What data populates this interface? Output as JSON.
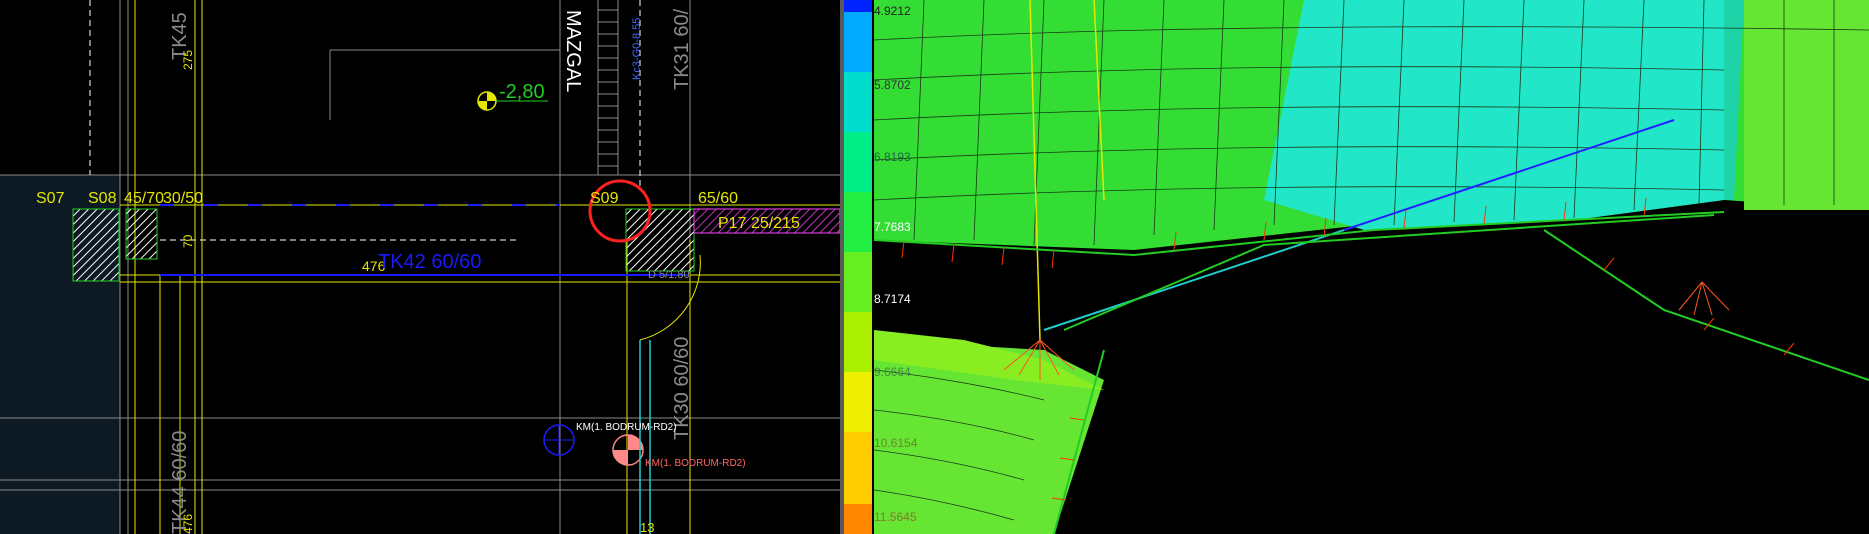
{
  "cad": {
    "labels": {
      "tk45": "TK45",
      "tk45_dim": "275",
      "mazgal": "MAZGAL",
      "vertical_small": "Kc3-G0-8 55",
      "tk31": "TK31 60/",
      "elevation": "-2,80",
      "s07": "S07",
      "s08": "S08",
      "c45_70": "45/70",
      "c30_50": "30/50",
      "s09": "S09",
      "c65_60": "65/60",
      "p17": "P17 25/215",
      "dim70": "70",
      "dim476": "476",
      "tk42": "TK42 60/60",
      "d_small": "D 5/1.80",
      "tk30": "TK30 60/60",
      "tk44": "TK44 60/60",
      "tk44_dim": "476",
      "km1": "KM(1. BODRUM-RD2)",
      "km2": "KM(1. BODRUM-RD2)",
      "dim13": "13"
    },
    "colors": {
      "yellow": "#e6e600",
      "blue": "#1a1aff",
      "green": "#22cc22",
      "red": "#ff2020",
      "gray": "#8a8a8a",
      "white": "#ffffff"
    }
  },
  "fem": {
    "legend": {
      "values": [
        "4.9212",
        "5.8702",
        "6.8193",
        "7.7683",
        "8.7174",
        "9.6664",
        "10.6154",
        "11.5645"
      ],
      "colors": [
        "#0022ff",
        "#00aaff",
        "#00ddcc",
        "#00ee88",
        "#22ee44",
        "#66ee22",
        "#aaee00",
        "#eeee00",
        "#ffcc00",
        "#ff8800"
      ]
    },
    "mesh_colors": {
      "cyan": "#22e6c8",
      "green": "#33dd33",
      "lime": "#66e633",
      "teal": "#1fd3a8"
    }
  }
}
